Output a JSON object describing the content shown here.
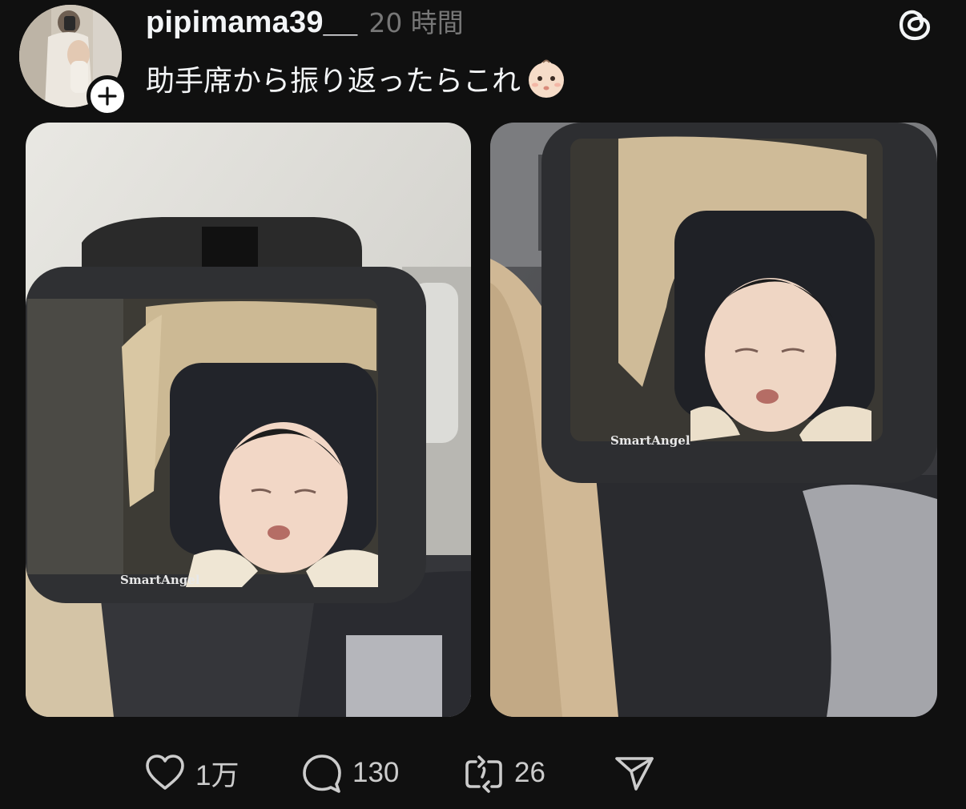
{
  "post": {
    "username": "pipimama39__",
    "timestamp": "20 時間",
    "caption": "助手席から振り返ったらこれ",
    "caption_emoji": "baby-face-emoji",
    "media": [
      {
        "brand_text": "SmartAngel"
      },
      {
        "brand_text": "SmartAngel"
      }
    ],
    "actions": {
      "likes": "1万",
      "replies": "130",
      "reposts": "26"
    }
  },
  "icons": {
    "follow": "plus-icon",
    "app_logo": "threads-logo-icon",
    "like": "heart-icon",
    "reply": "comment-bubble-icon",
    "repost": "repost-arrows-icon",
    "share": "paper-plane-icon"
  },
  "colors": {
    "background": "#101010",
    "primary_text": "#f3f5f7",
    "secondary_text": "#777777",
    "action_text": "#cccccc"
  }
}
